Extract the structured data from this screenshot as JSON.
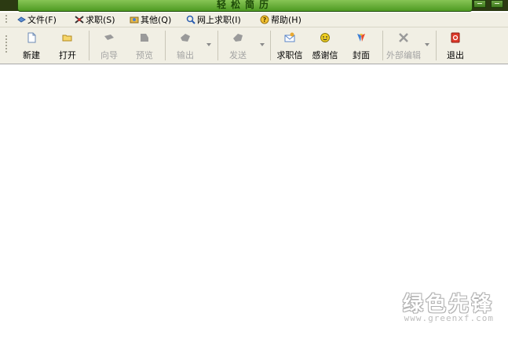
{
  "window": {
    "title": "轻松简历"
  },
  "menu": [
    {
      "label": "文件(F)",
      "icon": "file-icon"
    },
    {
      "label": "求职(S)",
      "icon": "job-icon"
    },
    {
      "label": "其他(Q)",
      "icon": "other-icon"
    },
    {
      "label": "网上求职(I)",
      "icon": "online-job-icon"
    },
    {
      "label": "帮助(H)",
      "icon": "help-icon"
    }
  ],
  "toolbar": {
    "new": "新建",
    "open": "打开",
    "wizard": "向导",
    "preview": "预览",
    "export": "输出",
    "send": "发送",
    "cover_letter": "求职信",
    "thank_you_letter": "感谢信",
    "cover": "封面",
    "external_edit": "外部编辑",
    "exit": "退出"
  },
  "watermark": {
    "title": "绿色先锋",
    "url": "www.greenxf.com"
  }
}
